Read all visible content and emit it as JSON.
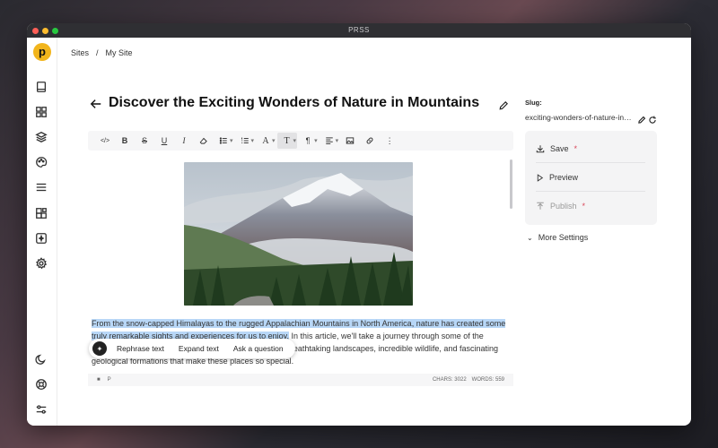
{
  "app": {
    "title": "PRSS",
    "logo_letter": "p"
  },
  "colors": {
    "accent": "#f2b51c",
    "highlight": "#b8d7f7",
    "required": "#d9465a"
  },
  "breadcrumb": {
    "root": "Sites",
    "separator": "/",
    "current": "My Site"
  },
  "sidebar": {
    "items": [
      {
        "icon": "book-icon"
      },
      {
        "icon": "dashboard-icon"
      },
      {
        "icon": "layers-icon"
      },
      {
        "icon": "palette-icon"
      },
      {
        "icon": "menu-icon"
      },
      {
        "icon": "blocks-icon"
      },
      {
        "icon": "plugin-icon"
      },
      {
        "icon": "gear-icon"
      }
    ],
    "bottom_items": [
      {
        "icon": "moon-icon"
      },
      {
        "icon": "help-icon"
      },
      {
        "icon": "sliders-icon"
      }
    ]
  },
  "editor": {
    "title": "Discover the Exciting Wonders of Nature in Mountains",
    "toolbar": {
      "code": "</>",
      "bold": "B",
      "strike": "S",
      "underline": "U",
      "italic": "I",
      "heading": "T",
      "paragraph": "¶",
      "font": "A",
      "more": "⋮"
    },
    "paragraph": {
      "highlighted": "From the snow-capped Himalayas to the rugged Appalachian Mountains in North America, nature has created some truly remarkable sights and experiences for us to enjoy.",
      "rest": " In this article, we'll take a journey through some of the world's most stunning mountain regions, exploring the breathtaking landscapes, incredible wildlife, and fascinating geological formations that make these places so special."
    },
    "ai_menu": {
      "rephrase": "Rephrase text",
      "expand": "Expand text",
      "ask": "Ask a question"
    },
    "status": {
      "path_1": "■",
      "path_2": "P",
      "chars": "CHARS: 3022",
      "words": "WORDS: 559"
    }
  },
  "panel": {
    "slug_label": "Slug:",
    "slug_value": "exciting-wonders-of-nature-in-mountains",
    "save": "Save",
    "preview": "Preview",
    "publish": "Publish",
    "required_mark": "*",
    "more_settings": "More Settings"
  }
}
